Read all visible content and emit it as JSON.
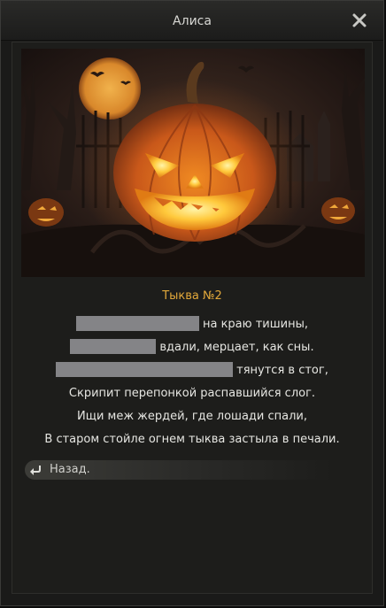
{
  "window": {
    "title": "Алиса",
    "close_icon": "close-icon"
  },
  "quest": {
    "title": "Тыква №2",
    "lines": [
      {
        "redacted": true,
        "text": "на краю тишины,"
      },
      {
        "redacted": true,
        "text": "вдали, мерцает, как сны."
      },
      {
        "redacted": true,
        "text": "тянутся в стог,"
      },
      {
        "redacted": false,
        "text": "Скрипит перепонкой распавшийся слог."
      },
      {
        "redacted": false,
        "text": "Ищи меж жердей, где лошади спали,"
      },
      {
        "redacted": false,
        "text": "В старом стойле огнем тыква застыла в печали."
      }
    ]
  },
  "back": {
    "label": "Назад.",
    "icon": "return-arrow-icon"
  },
  "colors": {
    "title_accent": "#e2a83a",
    "text": "#e6e6e2",
    "redaction": "#848487"
  }
}
